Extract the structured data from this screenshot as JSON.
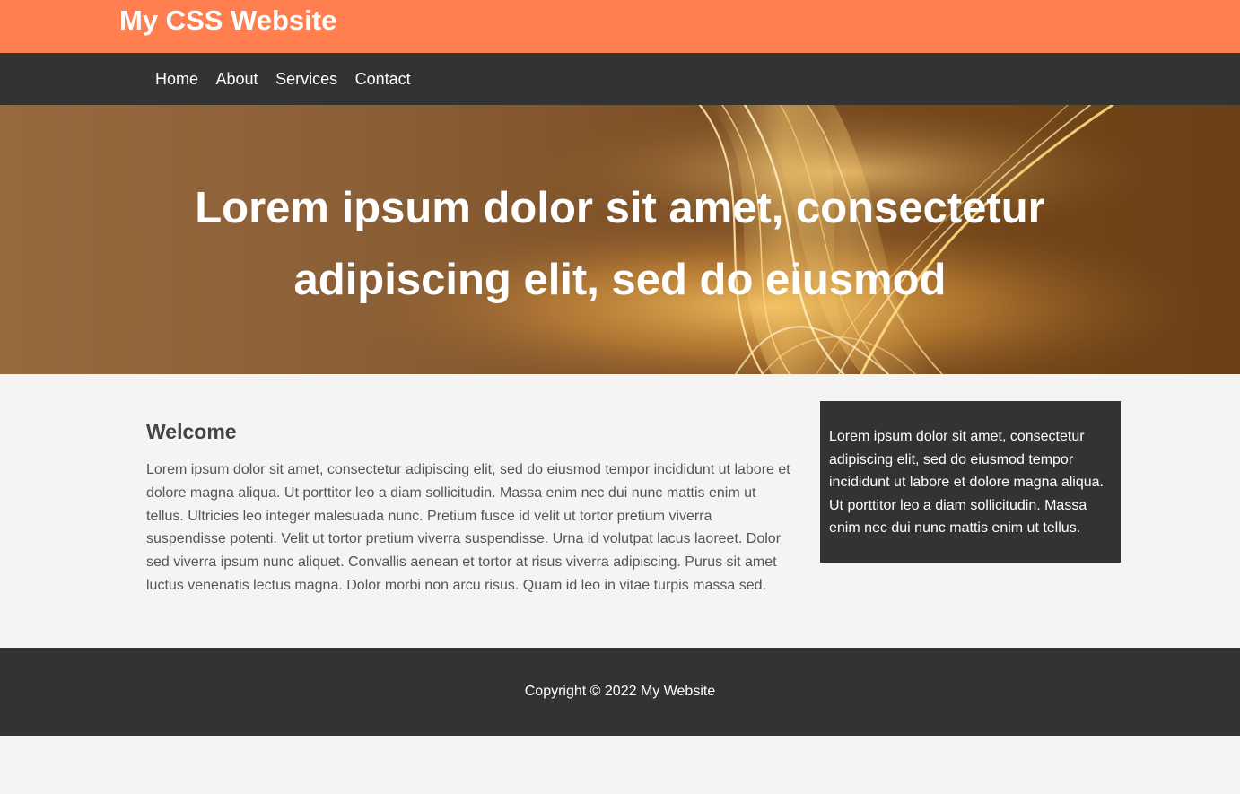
{
  "header": {
    "site_title": "My CSS Website",
    "brand_color": "#ff7f50"
  },
  "nav": {
    "items": [
      {
        "label": "Home"
      },
      {
        "label": "About"
      },
      {
        "label": "Services"
      },
      {
        "label": "Contact"
      }
    ]
  },
  "hero": {
    "heading": "Lorem ipsum dolor sit amet, consectetur adipiscing elit, sed do eiusmod",
    "background_image": "abstract-golden-light-waves"
  },
  "main": {
    "heading": "Welcome",
    "paragraph": "Lorem ipsum dolor sit amet, consectetur adipiscing elit, sed do eiusmod tempor incididunt ut labore et dolore magna aliqua. Ut porttitor leo a diam sollicitudin. Massa enim nec dui nunc mattis enim ut tellus. Ultricies leo integer malesuada nunc. Pretium fusce id velit ut tortor pretium viverra suspendisse potenti. Velit ut tortor pretium viverra suspendisse. Urna id volutpat lacus laoreet. Dolor sed viverra ipsum nunc aliquet. Convallis aenean et tortor at risus viverra adipiscing. Purus sit amet luctus venenatis lectus magna. Dolor morbi non arcu risus. Quam id leo in vitae turpis massa sed."
  },
  "sidebar": {
    "text": "Lorem ipsum dolor sit amet, consectetur adipiscing elit, sed do eiusmod tempor incididunt ut labore et dolore magna aliqua. Ut porttitor leo a diam sollicitudin. Massa enim nec dui nunc mattis enim ut tellus."
  },
  "footer": {
    "copyright": "Copyright © 2022 My Website"
  }
}
